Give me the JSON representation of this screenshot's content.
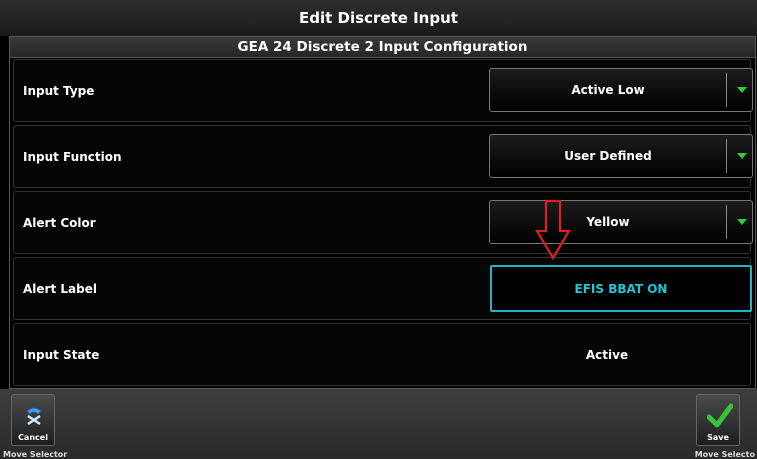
{
  "window": {
    "title": "Edit Discrete Input"
  },
  "panel": {
    "header": "GEA 24 Discrete 2 Input Configuration"
  },
  "rows": [
    {
      "label": "Input Type",
      "value": "Active Low"
    },
    {
      "label": "Input Function",
      "value": "User Defined"
    },
    {
      "label": "Alert Color",
      "value": "Yellow"
    },
    {
      "label": "Alert Label",
      "value": "EFIS BBAT ON"
    },
    {
      "label": "Input State",
      "value": "Active"
    }
  ],
  "softkeys": {
    "cancel": {
      "label": "Cancel",
      "icon": "undo-icon"
    },
    "save": {
      "label": "Save",
      "icon": "checkmark-icon"
    }
  },
  "hints": {
    "left": "Move Selector",
    "right": "Move Selecto"
  },
  "colors": {
    "accent_cyan": "#1fb4c9",
    "dropdown_arrow": "#27d13a",
    "annotation_red": "#e02020"
  }
}
